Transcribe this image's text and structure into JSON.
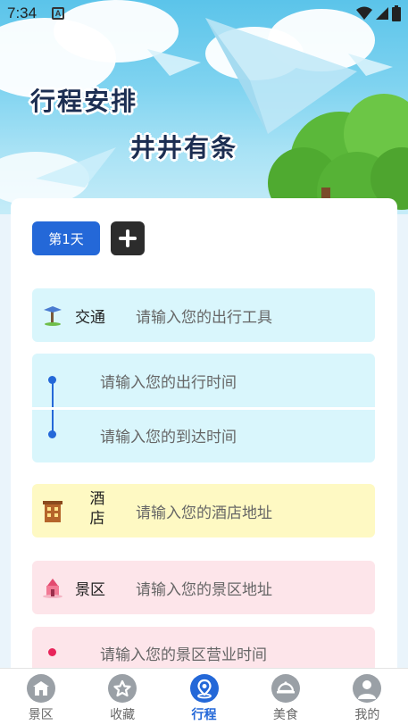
{
  "status_bar": {
    "time": "7:34",
    "notification_badge": "A"
  },
  "banner": {
    "title_line1": "行程安排",
    "title_line2": "井井有条"
  },
  "days": {
    "active_tab_label": "第1天"
  },
  "transport": {
    "label": "交通",
    "placeholder": "请输入您的出行工具",
    "depart_time_placeholder": "请输入您的出行时间",
    "arrive_time_placeholder": "请输入您的到达时间"
  },
  "hotel": {
    "label": "酒店",
    "placeholder": "请输入您的酒店地址"
  },
  "scenic": {
    "label": "景区",
    "placeholder": "请输入您的景区地址",
    "hours_placeholder": "请输入您的景区营业时间"
  },
  "nav": {
    "items": [
      {
        "label": "景区",
        "icon": "scenic-icon"
      },
      {
        "label": "收藏",
        "icon": "favorite-icon"
      },
      {
        "label": "行程",
        "icon": "itinerary-icon"
      },
      {
        "label": "美食",
        "icon": "food-icon"
      },
      {
        "label": "我的",
        "icon": "profile-icon"
      }
    ],
    "active_index": 2
  },
  "colors": {
    "accent": "#2468d8",
    "transport_bg": "#d9f6fc",
    "hotel_bg": "#fef9c3",
    "scenic_bg": "#fde5ea"
  }
}
